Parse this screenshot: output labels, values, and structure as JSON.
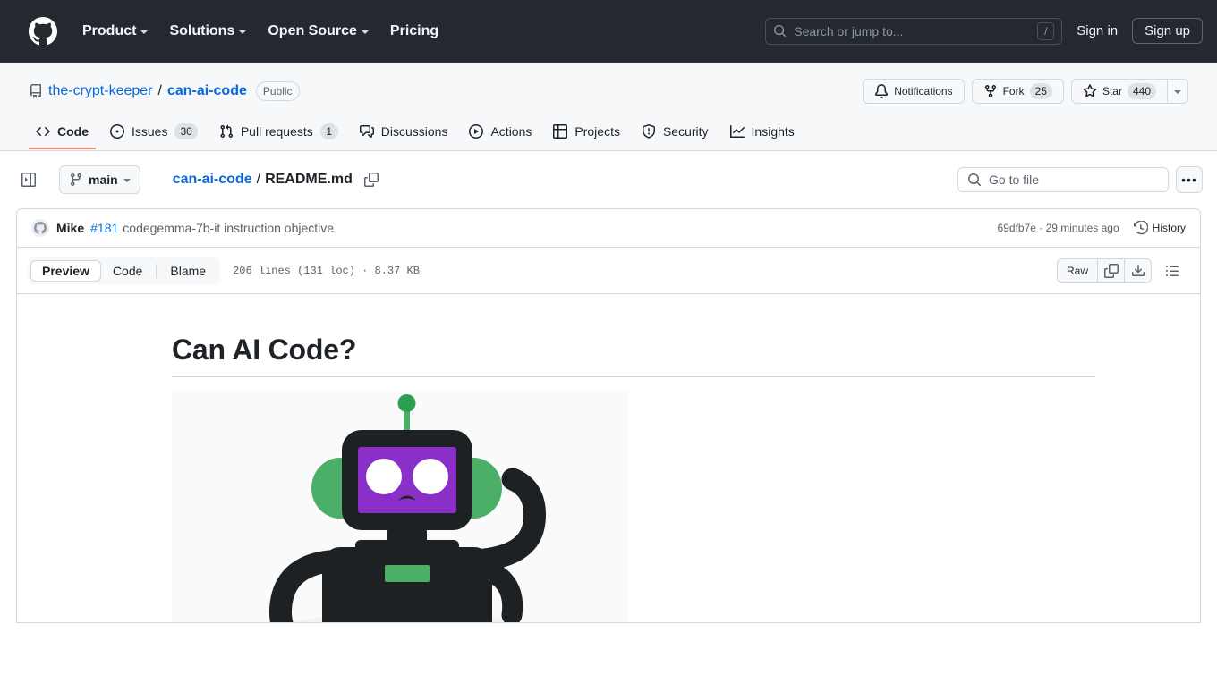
{
  "global_header": {
    "logo_icon": "github-mark-icon",
    "nav": [
      {
        "label": "Product",
        "has_caret": true
      },
      {
        "label": "Solutions",
        "has_caret": true
      },
      {
        "label": "Open Source",
        "has_caret": true
      },
      {
        "label": "Pricing",
        "has_caret": false
      }
    ],
    "search": {
      "icon": "search-icon",
      "placeholder": "Search or jump to...",
      "shortcut": "/"
    },
    "sign_in": "Sign in",
    "sign_up": "Sign up",
    "bg_color": "#24292f"
  },
  "repo": {
    "icon": "repo-icon",
    "owner": "the-crypt-keeper",
    "separator": "/",
    "name": "can-ai-code",
    "visibility": "Public",
    "actions": {
      "notifications": {
        "label": "Notifications",
        "icon": "bell-icon"
      },
      "fork": {
        "label": "Fork",
        "count": "25",
        "icon": "fork-icon"
      },
      "star": {
        "label": "Star",
        "count": "440",
        "icon": "star-icon"
      },
      "star_dropdown_icon": "chevron-down-icon"
    },
    "tabs": [
      {
        "label": "Code",
        "icon": "code-icon",
        "count": "",
        "active": true
      },
      {
        "label": "Issues",
        "icon": "issue-opened-icon",
        "count": "30",
        "active": false
      },
      {
        "label": "Pull requests",
        "icon": "git-pull-request-icon",
        "count": "1",
        "active": false
      },
      {
        "label": "Discussions",
        "icon": "comment-discussion-icon",
        "count": "",
        "active": false
      },
      {
        "label": "Actions",
        "icon": "play-icon",
        "count": "",
        "active": false
      },
      {
        "label": "Projects",
        "icon": "table-icon",
        "count": "",
        "active": false
      },
      {
        "label": "Security",
        "icon": "shield-icon",
        "count": "",
        "active": false
      },
      {
        "label": "Insights",
        "icon": "graph-icon",
        "count": "",
        "active": false
      }
    ],
    "active_tab_underline_color": "#fd8c73"
  },
  "file_nav": {
    "sidebar_toggle_icon": "sidebar-expand-icon",
    "branch": {
      "name": "main",
      "icon": "git-branch-icon",
      "caret_icon": "chevron-down-icon"
    },
    "breadcrumb": {
      "repo": "can-ai-code",
      "separator": "/",
      "file": "README.md"
    },
    "copy_path_icon": "copy-icon",
    "go_to_file": {
      "placeholder": "Go to file",
      "icon": "search-icon"
    },
    "more_label": "•••"
  },
  "commit": {
    "avatar_icon": "user-avatar",
    "author": "Mike",
    "pr_number": "#181",
    "message": "codegemma-7b-it instruction objective",
    "sha": "69dfb7e",
    "meta": "69dfb7e · 29 minutes ago",
    "history_label": "History",
    "history_icon": "history-icon"
  },
  "file_view": {
    "tabs": [
      {
        "label": "Preview",
        "active": true
      },
      {
        "label": "Code",
        "active": false
      },
      {
        "label": "Blame",
        "active": false
      }
    ],
    "meta": "206 lines (131 loc) · 8.37 KB",
    "raw_label": "Raw",
    "copy_icon": "copy-icon",
    "download_icon": "download-icon",
    "outline_icon": "list-unordered-icon"
  },
  "readme": {
    "heading": "Can AI Code?",
    "image_alt": "robot-illustration",
    "colors": {
      "robot_body": "#1d2124",
      "robot_face": "#8b2fc9",
      "robot_accent": "#4caf68",
      "image_bg": "#fafafa"
    }
  }
}
